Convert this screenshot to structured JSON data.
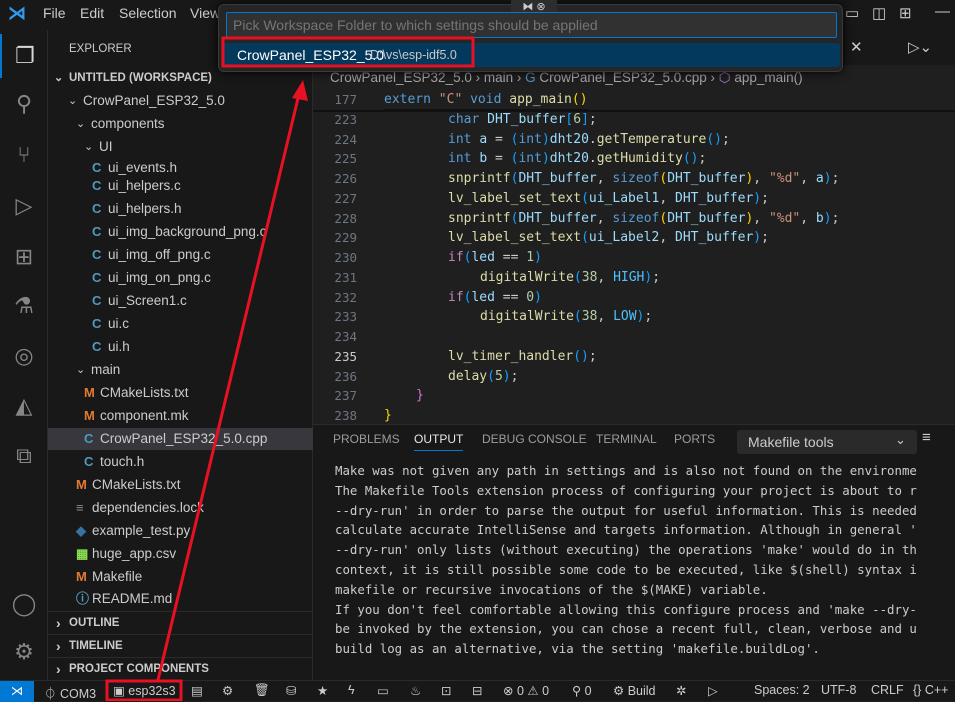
{
  "menu": [
    "File",
    "Edit",
    "Selection",
    "View"
  ],
  "quickpick": {
    "placeholder": "Pick Workspace Folder to which settings should be applied",
    "item_name": "CrowPanel_ESP32_5.0",
    "item_path": "D:\\vs\\esp-idf5.0"
  },
  "explorer": {
    "title": "EXPLORER",
    "workspace": "UNTITLED (WORKSPACE)",
    "tree": [
      {
        "label": "CrowPanel_ESP32_5.0",
        "type": "folder",
        "level": 1
      },
      {
        "label": "components",
        "type": "folder",
        "level": 2
      },
      {
        "label": "UI",
        "type": "folder",
        "level": 3
      },
      {
        "label": "ui_events.h",
        "type": "c",
        "level": 4
      },
      {
        "label": "ui_helpers.c",
        "type": "c",
        "level": 4
      },
      {
        "label": "ui_helpers.h",
        "type": "c",
        "level": 4
      },
      {
        "label": "ui_img_background_png.c",
        "type": "c",
        "level": 4
      },
      {
        "label": "ui_img_off_png.c",
        "type": "c",
        "level": 4
      },
      {
        "label": "ui_img_on_png.c",
        "type": "c",
        "level": 4
      },
      {
        "label": "ui_Screen1.c",
        "type": "c",
        "level": 4
      },
      {
        "label": "ui.c",
        "type": "c",
        "level": 4
      },
      {
        "label": "ui.h",
        "type": "c",
        "level": 4
      },
      {
        "label": "main",
        "type": "folder",
        "level": 2
      },
      {
        "label": "CMakeLists.txt",
        "type": "cmake",
        "level": 3
      },
      {
        "label": "component.mk",
        "type": "mk",
        "level": 3
      },
      {
        "label": "CrowPanel_ESP32_5.0.cpp",
        "type": "cpp",
        "level": 3,
        "selected": true
      },
      {
        "label": "touch.h",
        "type": "c",
        "level": 3
      },
      {
        "label": "CMakeLists.txt",
        "type": "cmake",
        "level": 2
      },
      {
        "label": "dependencies.lock",
        "type": "lock",
        "level": 2
      },
      {
        "label": "example_test.py",
        "type": "py",
        "level": 2
      },
      {
        "label": "huge_app.csv",
        "type": "csv",
        "level": 2
      },
      {
        "label": "Makefile",
        "type": "mk",
        "level": 2
      },
      {
        "label": "README.md",
        "type": "md",
        "level": 2
      }
    ],
    "sections": [
      "OUTLINE",
      "TIMELINE",
      "PROJECT COMPONENTS"
    ]
  },
  "breadcrumb": [
    "CrowPanel_ESP32_5.0",
    "main",
    "CrowPanel_ESP32_5.0.cpp",
    "app_main()"
  ],
  "code": [
    {
      "n": "177",
      "ind": 0,
      "t": [
        [
          "extern ",
          "kw"
        ],
        [
          "\"C\" ",
          "str"
        ],
        [
          "void ",
          "kw"
        ],
        [
          "app_main",
          "fn"
        ],
        [
          "()",
          "p1"
        ]
      ]
    },
    {
      "n": "223",
      "ind": 2,
      "t": [
        [
          "char ",
          "kw"
        ],
        [
          "DHT_buffer",
          "id"
        ],
        [
          "[",
          "p3"
        ],
        [
          "6",
          "num"
        ],
        [
          "]",
          "p3"
        ],
        [
          ";",
          "pl"
        ]
      ]
    },
    {
      "n": "224",
      "ind": 2,
      "t": [
        [
          "int ",
          "kw"
        ],
        [
          "a ",
          "id"
        ],
        [
          "= ",
          "pl"
        ],
        [
          "(",
          "p3"
        ],
        [
          "int",
          "kw"
        ],
        [
          ")",
          "p3"
        ],
        [
          "dht20",
          "id"
        ],
        [
          ".",
          "pl"
        ],
        [
          "getTemperature",
          "fn"
        ],
        [
          "()",
          "p3"
        ],
        [
          ";",
          "pl"
        ]
      ]
    },
    {
      "n": "225",
      "ind": 2,
      "t": [
        [
          "int ",
          "kw"
        ],
        [
          "b ",
          "id"
        ],
        [
          "= ",
          "pl"
        ],
        [
          "(",
          "p3"
        ],
        [
          "int",
          "kw"
        ],
        [
          ")",
          "p3"
        ],
        [
          "dht20",
          "id"
        ],
        [
          ".",
          "pl"
        ],
        [
          "getHumidity",
          "fn"
        ],
        [
          "()",
          "p3"
        ],
        [
          ";",
          "pl"
        ]
      ]
    },
    {
      "n": "226",
      "ind": 2,
      "t": [
        [
          "snprintf",
          "fn"
        ],
        [
          "(",
          "p3"
        ],
        [
          "DHT_buffer",
          "id"
        ],
        [
          ", ",
          "pl"
        ],
        [
          "sizeof",
          "kw"
        ],
        [
          "(",
          "p1"
        ],
        [
          "DHT_buffer",
          "id"
        ],
        [
          ")",
          "p1"
        ],
        [
          ", ",
          "pl"
        ],
        [
          "\"%d\"",
          "str"
        ],
        [
          ", ",
          "pl"
        ],
        [
          "a",
          "id"
        ],
        [
          ")",
          "p3"
        ],
        [
          ";",
          "pl"
        ]
      ]
    },
    {
      "n": "227",
      "ind": 2,
      "t": [
        [
          "lv_label_set_text",
          "fn"
        ],
        [
          "(",
          "p3"
        ],
        [
          "ui_Label1",
          "id"
        ],
        [
          ", ",
          "pl"
        ],
        [
          "DHT_buffer",
          "id"
        ],
        [
          ")",
          "p3"
        ],
        [
          ";",
          "pl"
        ]
      ]
    },
    {
      "n": "228",
      "ind": 2,
      "t": [
        [
          "snprintf",
          "fn"
        ],
        [
          "(",
          "p3"
        ],
        [
          "DHT_buffer",
          "id"
        ],
        [
          ", ",
          "pl"
        ],
        [
          "sizeof",
          "kw"
        ],
        [
          "(",
          "p1"
        ],
        [
          "DHT_buffer",
          "id"
        ],
        [
          ")",
          "p1"
        ],
        [
          ", ",
          "pl"
        ],
        [
          "\"%d\"",
          "str"
        ],
        [
          ", ",
          "pl"
        ],
        [
          "b",
          "id"
        ],
        [
          ")",
          "p3"
        ],
        [
          ";",
          "pl"
        ]
      ]
    },
    {
      "n": "229",
      "ind": 2,
      "t": [
        [
          "lv_label_set_text",
          "fn"
        ],
        [
          "(",
          "p3"
        ],
        [
          "ui_Label2",
          "id"
        ],
        [
          ", ",
          "pl"
        ],
        [
          "DHT_buffer",
          "id"
        ],
        [
          ")",
          "p3"
        ],
        [
          ";",
          "pl"
        ]
      ]
    },
    {
      "n": "230",
      "ind": 2,
      "t": [
        [
          "if",
          "ctl"
        ],
        [
          "(",
          "p3"
        ],
        [
          "led ",
          "id"
        ],
        [
          "== ",
          "pl"
        ],
        [
          "1",
          "num"
        ],
        [
          ")",
          "p3"
        ]
      ]
    },
    {
      "n": "231",
      "ind": 3,
      "t": [
        [
          "digitalWrite",
          "fn"
        ],
        [
          "(",
          "p3"
        ],
        [
          "38",
          "num"
        ],
        [
          ", ",
          "pl"
        ],
        [
          "HIGH",
          "mac"
        ],
        [
          ")",
          "p3"
        ],
        [
          ";",
          "pl"
        ]
      ]
    },
    {
      "n": "232",
      "ind": 2,
      "t": [
        [
          "if",
          "ctl"
        ],
        [
          "(",
          "p3"
        ],
        [
          "led ",
          "id"
        ],
        [
          "== ",
          "pl"
        ],
        [
          "0",
          "num"
        ],
        [
          ")",
          "p3"
        ]
      ]
    },
    {
      "n": "233",
      "ind": 3,
      "t": [
        [
          "digitalWrite",
          "fn"
        ],
        [
          "(",
          "p3"
        ],
        [
          "38",
          "num"
        ],
        [
          ", ",
          "pl"
        ],
        [
          "LOW",
          "mac"
        ],
        [
          ")",
          "p3"
        ],
        [
          ";",
          "pl"
        ]
      ]
    },
    {
      "n": "234",
      "ind": 2,
      "t": []
    },
    {
      "n": "235",
      "ind": 2,
      "t": [
        [
          "lv_timer_handler",
          "fn"
        ],
        [
          "()",
          "p3"
        ],
        [
          ";",
          "pl"
        ]
      ],
      "current": true
    },
    {
      "n": "236",
      "ind": 2,
      "t": [
        [
          "delay",
          "fn"
        ],
        [
          "(",
          "p3"
        ],
        [
          "5",
          "num"
        ],
        [
          ")",
          "p3"
        ],
        [
          ";",
          "pl"
        ]
      ]
    },
    {
      "n": "237",
      "ind": 1,
      "t": [
        [
          "}",
          "p2"
        ]
      ]
    },
    {
      "n": "238",
      "ind": 0,
      "t": [
        [
          "}",
          "p1"
        ]
      ]
    }
  ],
  "panel": {
    "tabs": [
      "PROBLEMS",
      "OUTPUT",
      "DEBUG CONSOLE",
      "TERMINAL",
      "PORTS"
    ],
    "active": "OUTPUT",
    "channel": "Makefile tools",
    "lines": [
      "Make was not given any path in settings and is also not found on the environme",
      "The Makefile Tools extension process of configuring your project is about to r",
      "--dry-run' in order to parse the output for useful information. This is needed",
      "calculate accurate IntelliSense and targets information. Although in general '",
      "--dry-run' only lists (without executing) the operations 'make' would do in th",
      "context, it is still possible some code to be executed, like $(shell) syntax i",
      "makefile or recursive invocations of the $(MAKE) variable.",
      "If you don't feel comfortable allowing this configure process and 'make --dry-",
      "be invoked by the extension, you can chose a recent full, clean, verbose and u",
      "build log as an alternative, via the setting 'makefile.buildLog'."
    ]
  },
  "status": {
    "port": "COM3",
    "target": "esp32s3",
    "errors": "0",
    "warnings": "0",
    "ports": "0",
    "build": "Build",
    "spaces": "Spaces: 2",
    "encoding": "UTF-8",
    "eol": "CRLF",
    "language": "{} C++"
  },
  "colors": {
    "accent": "#0078d4",
    "selection": "#04395e",
    "annotation": "#e81123"
  }
}
